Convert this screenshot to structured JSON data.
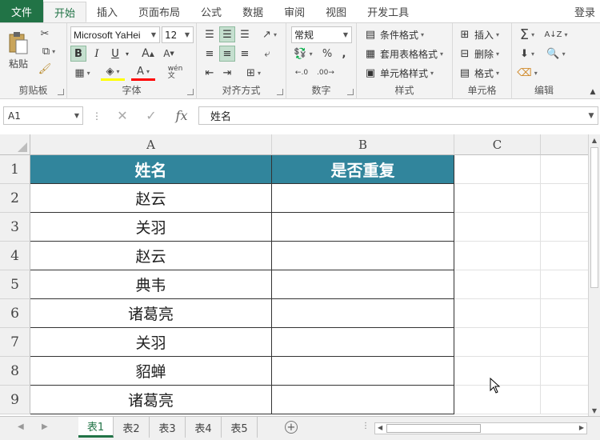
{
  "tabs": {
    "file": "文件",
    "items": [
      "开始",
      "插入",
      "页面布局",
      "公式",
      "数据",
      "审阅",
      "视图",
      "开发工具"
    ],
    "active": 0,
    "login": "登录"
  },
  "ribbon": {
    "clipboard": {
      "label": "剪贴板",
      "paste": "粘贴"
    },
    "font": {
      "label": "字体",
      "family": "Microsoft YaHei",
      "size": "12",
      "bold": "B",
      "italic": "I",
      "underline": "U",
      "wen": "wén\n文"
    },
    "alignment": {
      "label": "对齐方式"
    },
    "number": {
      "label": "数字",
      "format": "常规"
    },
    "styles": {
      "label": "样式",
      "conditional": "条件格式",
      "table": "套用表格格式",
      "cell": "单元格样式"
    },
    "cells": {
      "label": "单元格",
      "insert": "插入",
      "delete": "删除",
      "format": "格式"
    },
    "editing": {
      "label": "编辑"
    }
  },
  "formula_bar": {
    "name_box": "A1",
    "fx": "fx",
    "content": "姓名"
  },
  "grid": {
    "columns": [
      "A",
      "B",
      "C"
    ],
    "rows": [
      "1",
      "2",
      "3",
      "4",
      "5",
      "6",
      "7",
      "8",
      "9"
    ],
    "header": [
      "姓名",
      "是否重复"
    ],
    "names": [
      "赵云",
      "关羽",
      "赵云",
      "典韦",
      "诸葛亮",
      "关羽",
      "貂蝉",
      "诸葛亮"
    ],
    "header_color": "#31859c"
  },
  "sheets": {
    "tabs": [
      "表1",
      "表2",
      "表3",
      "表4",
      "表5"
    ],
    "active": 0
  },
  "colors": {
    "accent": "#217346"
  }
}
